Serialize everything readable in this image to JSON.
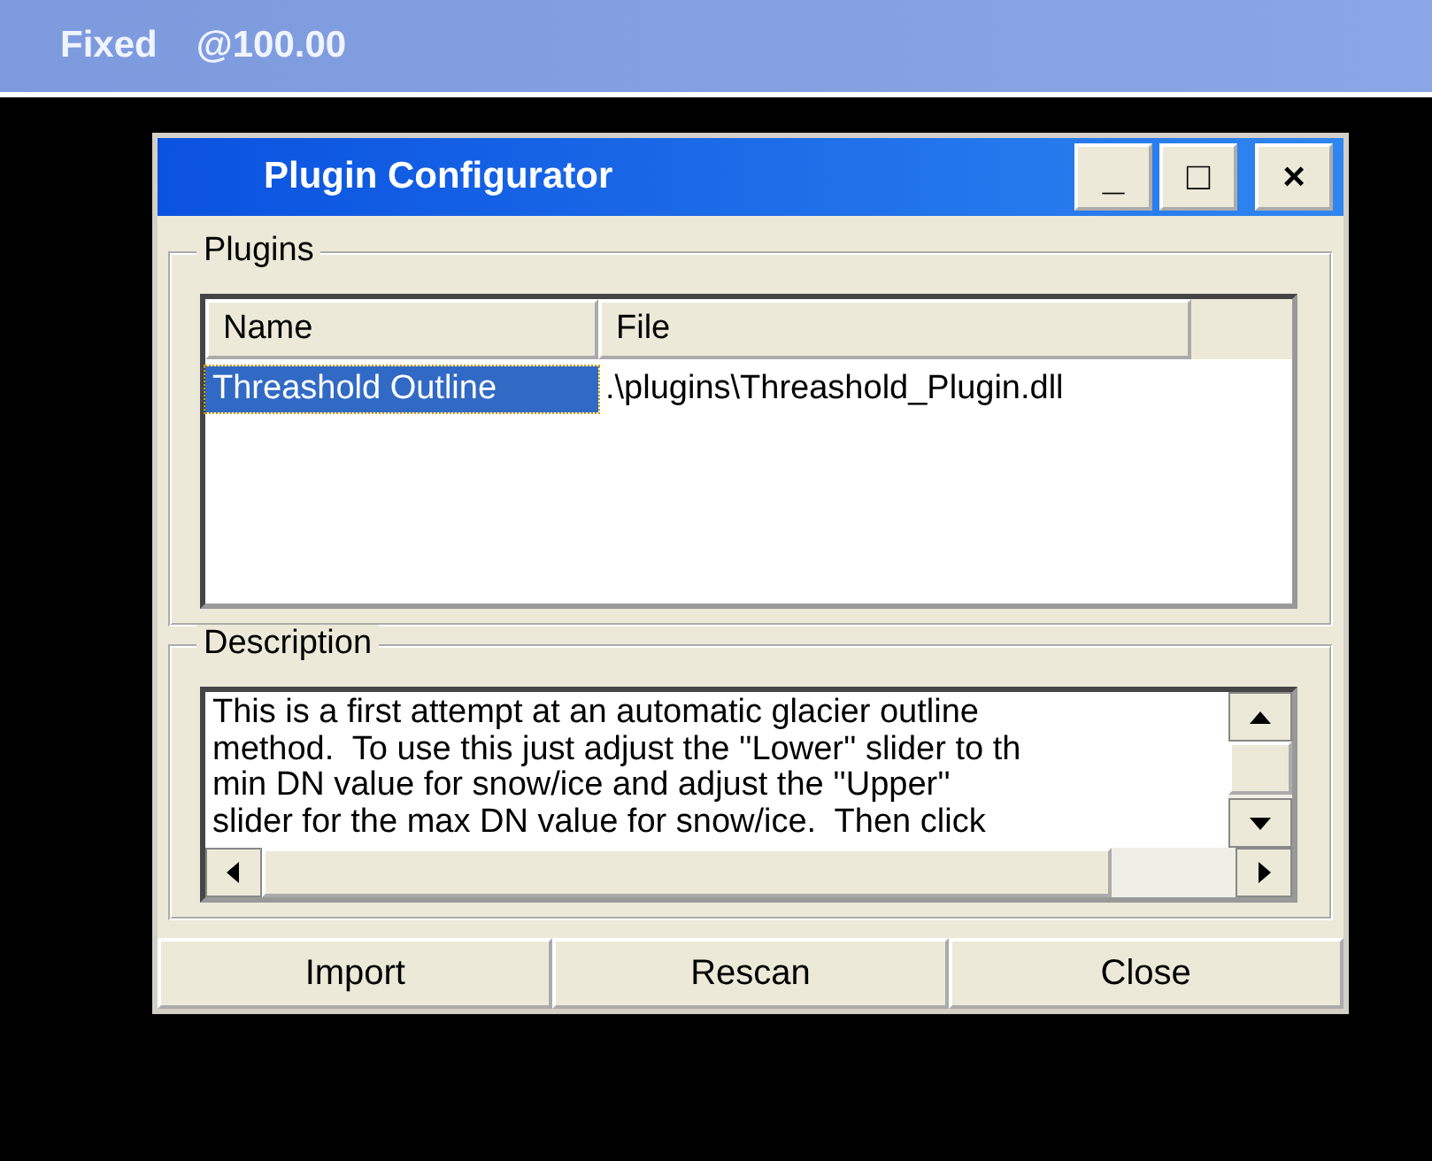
{
  "top_bar": {
    "mode": "Fixed",
    "zoom": "@100.00"
  },
  "window": {
    "title": "Plugin Configurator",
    "controls": [
      "_",
      "□",
      "×"
    ]
  },
  "plugins": {
    "label": "Plugins",
    "columns": [
      "Name",
      "File"
    ],
    "rows": [
      {
        "name": "Threashold Outline",
        "file": ".\\plugins\\Threashold_Plugin.dll",
        "selected": true
      }
    ]
  },
  "description": {
    "label": "Description",
    "lines": [
      "This is a first attempt at an automatic glacier outline",
      "method.  To use this just adjust the ''Lower'' slider to th",
      "min DN value for snow/ice and adjust the ''Upper''",
      "slider for the max DN value for snow/ice.  Then click"
    ]
  },
  "buttons": [
    "Import",
    "Rescan",
    "Close"
  ]
}
